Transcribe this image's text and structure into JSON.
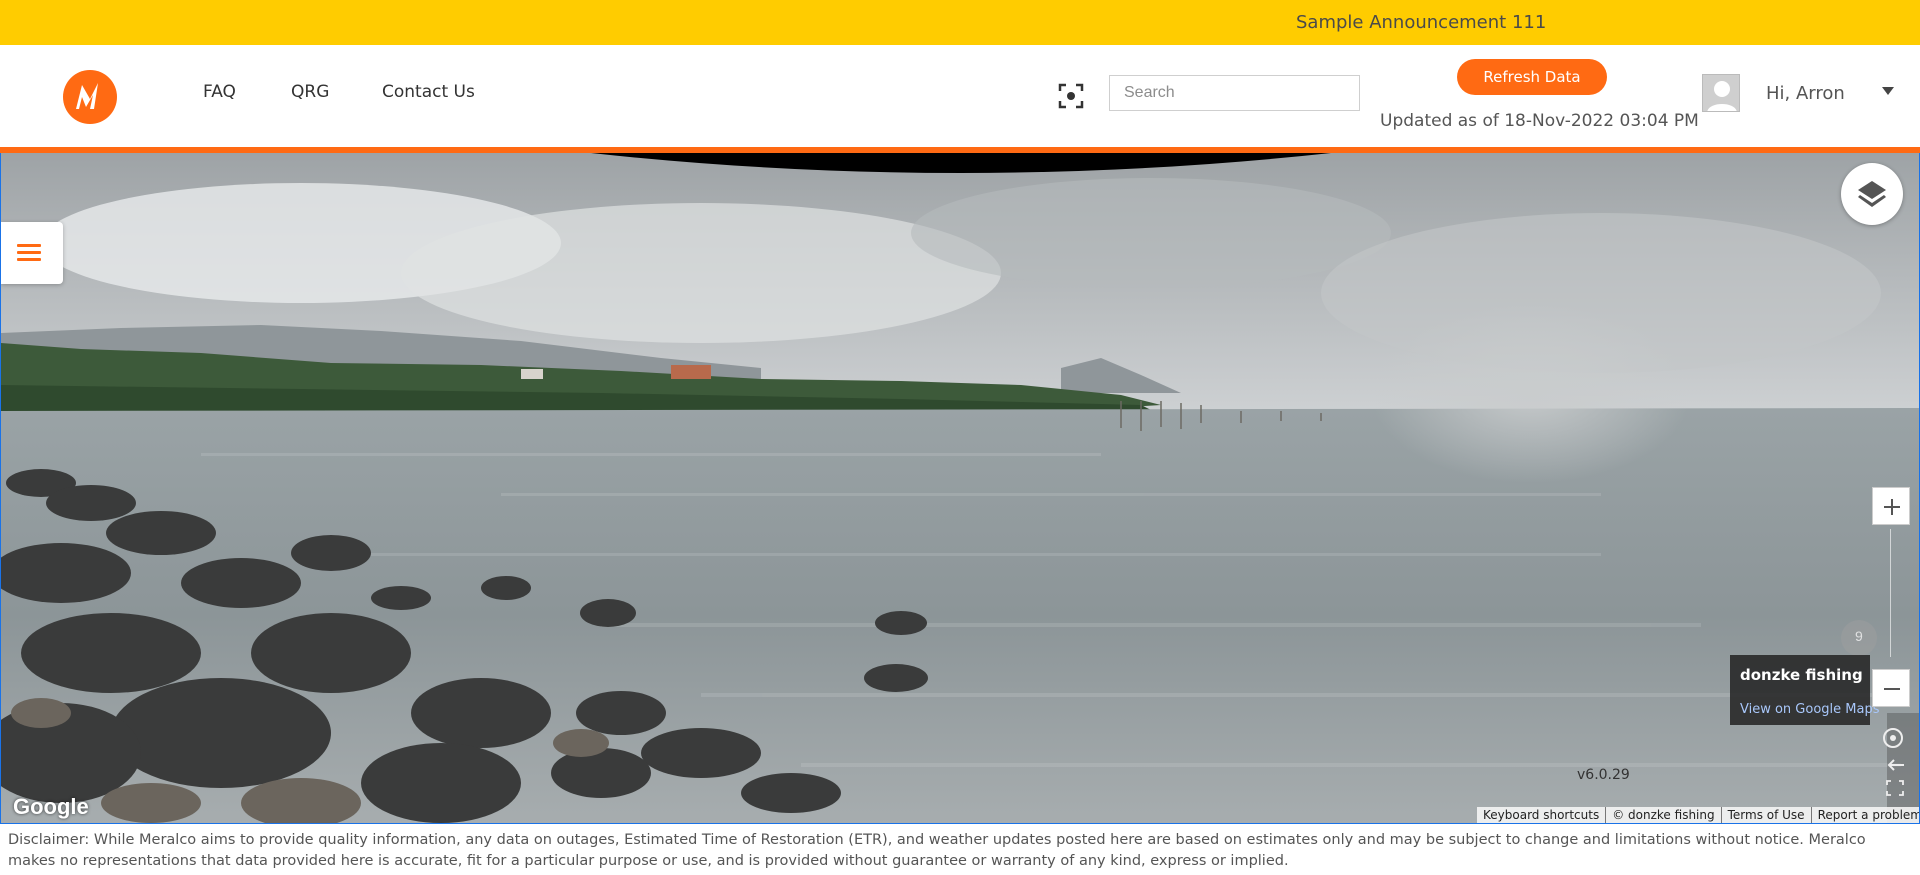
{
  "announcement": {
    "text": "Sample Announcement 111"
  },
  "header": {
    "nav": [
      {
        "label": "FAQ"
      },
      {
        "label": "QRG"
      },
      {
        "label": "Contact Us"
      }
    ],
    "search": {
      "placeholder": "Search",
      "value": ""
    },
    "refresh_label": "Refresh Data",
    "updated_text": "Updated as of 18-Nov-2022 03:04 PM",
    "greeting": "Hi, Arron"
  },
  "map": {
    "place_card": {
      "title": "donzke fishing",
      "link": "View on Google Maps"
    },
    "zoom_knob_label": "9",
    "version": "v6.0.29",
    "google_logo": "Google",
    "attribution": [
      "Keyboard shortcuts",
      "© donzke fishing",
      "Terms of Use",
      "Report a problem"
    ]
  },
  "disclaimer": "Disclaimer: While Meralco aims to provide quality information, any data on outages, Estimated Time of Restoration (ETR), and weather updates posted here are based on estimates only and may be subject to change and limitations without notice. Meralco makes no representations that data provided here is accurate, fit for a particular purpose or use, and is provided without guarantee or warranty of any kind, express or implied.",
  "colors": {
    "announcement_bg": "#ffcc00",
    "brand_orange": "#ff6a13",
    "map_border": "#1a73e8"
  },
  "icons": [
    "meralco-logo",
    "scan-icon",
    "avatar",
    "chevron-down-icon",
    "layers-icon",
    "hamburger-menu-icon",
    "zoom-in-icon",
    "zoom-out-icon",
    "compass-icon",
    "back-arrow-icon",
    "fullscreen-icon"
  ]
}
